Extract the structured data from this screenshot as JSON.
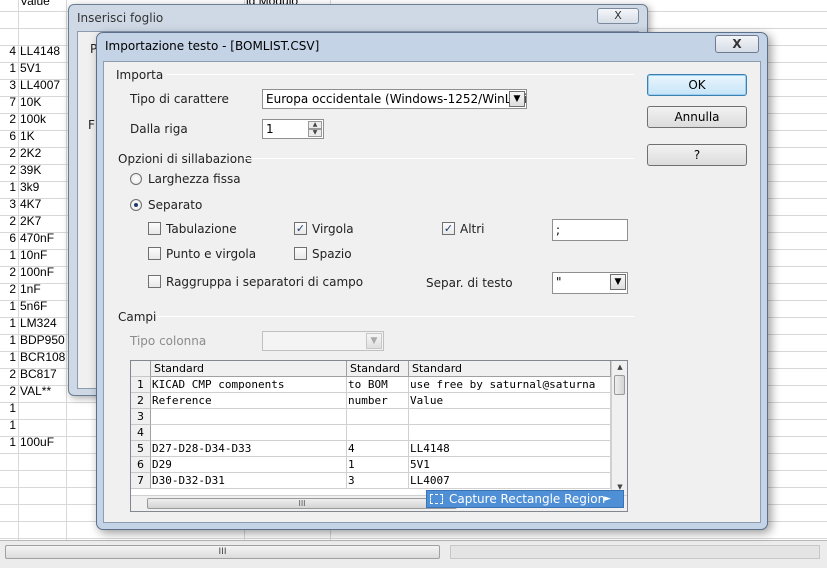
{
  "spreadsheet": {
    "header_partial": [
      "Value",
      "ld Modulo"
    ],
    "rows": [
      {
        "qty": "4",
        "value": "LL4148"
      },
      {
        "qty": "1",
        "value": "5V1"
      },
      {
        "qty": "3",
        "value": "LL4007"
      },
      {
        "qty": "7",
        "value": "10K"
      },
      {
        "qty": "2",
        "value": "100k"
      },
      {
        "qty": "6",
        "value": "1K"
      },
      {
        "qty": "2",
        "value": "2K2"
      },
      {
        "qty": "2",
        "value": "39K"
      },
      {
        "qty": "1",
        "value": "3k9"
      },
      {
        "qty": "3",
        "value": "4K7"
      },
      {
        "qty": "2",
        "value": "2K7"
      },
      {
        "qty": "6",
        "value": "470nF"
      },
      {
        "qty": "1",
        "value": "10nF"
      },
      {
        "qty": "2",
        "value": "100nF"
      },
      {
        "qty": "2",
        "value": "1nF"
      },
      {
        "qty": "1",
        "value": "5n6F"
      },
      {
        "qty": "1",
        "value": "LM324"
      },
      {
        "qty": "1",
        "value": "BDP950"
      },
      {
        "qty": "1",
        "value": "BCR108"
      },
      {
        "qty": "2",
        "value": "BC817"
      },
      {
        "qty": "2",
        "value": "VAL**"
      },
      {
        "qty": "1",
        "value": ""
      },
      {
        "qty": "1",
        "value": ""
      },
      {
        "qty": "1",
        "value": "100uF"
      }
    ],
    "hscroll_grip": "III"
  },
  "back_dialog": {
    "title": "Inserisci foglio",
    "close": "X",
    "label_p": "P",
    "label_f": "F"
  },
  "dialog": {
    "title": "Importazione testo - [BOMLIST.CSV]",
    "close": "X",
    "import": {
      "section": "Importa",
      "charset_label": "Tipo di carattere",
      "charset_value": "Europa occidentale (Windows-1252/WinLatin 1)",
      "from_row_label": "Dalla riga",
      "from_row_value": "1"
    },
    "separator": {
      "section": "Opzioni di sillabazione",
      "fixed_width": "Larghezza fissa",
      "separated": "Separato",
      "tab": "Tabulazione",
      "comma": "Virgola",
      "other": "Altri",
      "other_value": ";",
      "semicolon": "Punto e virgola",
      "space": "Spazio",
      "merge": "Raggruppa i separatori di campo",
      "text_delim_label": "Separ. di testo",
      "text_delim_value": "\""
    },
    "fields": {
      "section": "Campi",
      "column_type_label": "Tipo colonna",
      "column_type_value": "",
      "headers": [
        "Standard",
        "Standard",
        "Standard"
      ],
      "rows": [
        {
          "n": "1",
          "a": "KICAD CMP components",
          "b": " to BOM",
          "c": " use free by saturnal@saturna"
        },
        {
          "n": "2",
          "a": "Reference",
          "b": "number",
          "c": "Value"
        },
        {
          "n": "3",
          "a": "",
          "b": "",
          "c": ""
        },
        {
          "n": "4",
          "a": "",
          "b": "",
          "c": ""
        },
        {
          "n": "5",
          "a": "D27-D28-D34-D33",
          "b": " 4",
          "c": "LL4148"
        },
        {
          "n": "6",
          "a": "D29",
          "b": " 1",
          "c": "5V1"
        },
        {
          "n": "7",
          "a": "D30-D32-D31",
          "b": " 3",
          "c": "LL4007"
        }
      ],
      "hscroll_grip": "III"
    },
    "buttons": {
      "ok": "OK",
      "cancel": "Annulla",
      "help": "?"
    },
    "capture": "Capture Rectangle Region"
  },
  "colors": {
    "title_bar": "#c4d3e6",
    "default_button": "#c6e4f7",
    "capture_bg": "#4f8fd6"
  }
}
